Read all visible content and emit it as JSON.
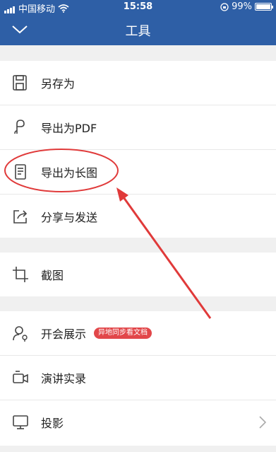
{
  "status_bar": {
    "carrier": "中国移动",
    "time": "15:58",
    "battery": "99%"
  },
  "header": {
    "title": "工具"
  },
  "menu_groups": [
    {
      "items": [
        {
          "label": "另存为",
          "icon": "save-icon"
        },
        {
          "label": "导出为PDF",
          "icon": "pdf-icon"
        },
        {
          "label": "导出为长图",
          "icon": "long-image-icon"
        },
        {
          "label": "分享与发送",
          "icon": "share-icon"
        }
      ]
    },
    {
      "items": [
        {
          "label": "截图",
          "icon": "crop-icon"
        }
      ]
    },
    {
      "items": [
        {
          "label": "开会展示",
          "icon": "meeting-icon",
          "badge": "异地同步看文档"
        },
        {
          "label": "演讲实录",
          "icon": "video-icon"
        },
        {
          "label": "投影",
          "icon": "monitor-icon"
        }
      ]
    }
  ],
  "colors": {
    "header_bg": "#2e5fa6",
    "badge_bg": "#e2474a",
    "annotation": "#e03a3a"
  }
}
